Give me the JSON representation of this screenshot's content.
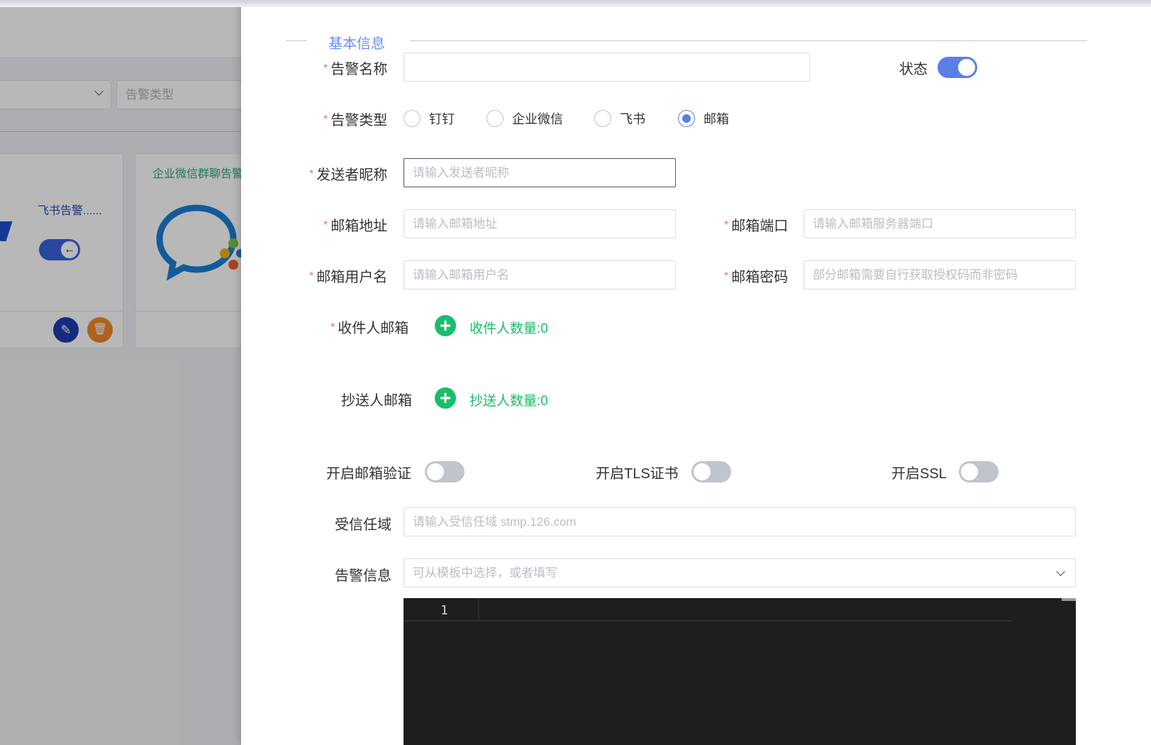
{
  "background": {
    "type_filter_placeholder": "告警类型",
    "cards": [
      {
        "name": "飞书告警......",
        "enabled": true
      },
      {
        "name": "企业微信群聊告警"
      }
    ]
  },
  "form": {
    "section_title": "基本信息",
    "alert_name": {
      "label": "告警名称",
      "value": ""
    },
    "status": {
      "label": "状态",
      "on": true
    },
    "alert_type": {
      "label": "告警类型",
      "options": [
        "钉钉",
        "企业微信",
        "飞书",
        "邮箱"
      ],
      "selected": "邮箱"
    },
    "sender_nickname": {
      "label": "发送者昵称",
      "placeholder": "请输入发送者昵称"
    },
    "email_address": {
      "label": "邮箱地址",
      "placeholder": "请输入邮箱地址"
    },
    "email_port": {
      "label": "邮箱端口",
      "placeholder": "请输入邮箱服务器端口"
    },
    "email_username": {
      "label": "邮箱用户名",
      "placeholder": "请输入邮箱用户名"
    },
    "email_password": {
      "label": "邮箱密码",
      "placeholder": "部分邮箱需要自行获取授权码而非密码"
    },
    "recipient_email": {
      "label": "收件人邮箱",
      "count_text": "收件人数量:0"
    },
    "cc_email": {
      "label": "抄送人邮箱",
      "count_text": "抄送人数量:0"
    },
    "email_verify": {
      "label": "开启邮箱验证",
      "on": false
    },
    "tls_cert": {
      "label": "开启TLS证书",
      "on": false
    },
    "ssl": {
      "label": "开启SSL",
      "on": false
    },
    "trusted_domain": {
      "label": "受信任域",
      "placeholder": "请输入受信任域 stmp.126.com"
    },
    "alert_info": {
      "label": "告警信息",
      "placeholder": "可从模板中选择，或者填写"
    },
    "editor": {
      "line_number": "1"
    }
  }
}
